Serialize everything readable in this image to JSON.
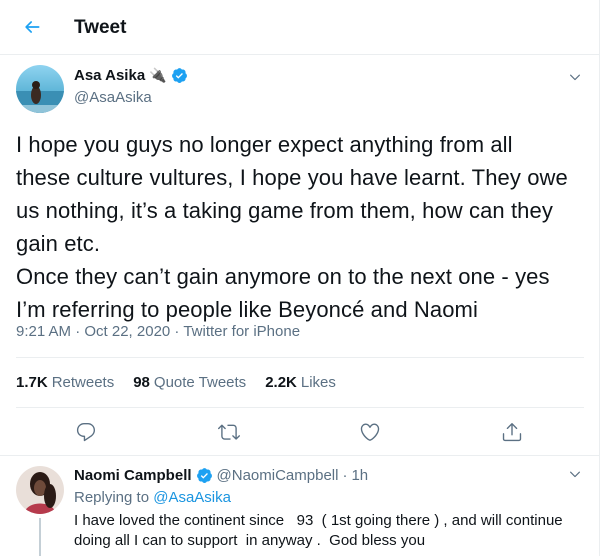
{
  "header": {
    "title": "Tweet"
  },
  "tweet": {
    "author_name": "Asa Asika",
    "author_emoji": "🔌",
    "author_handle": "@AsaAsika",
    "text_lines": [
      "I hope you guys no longer expect anything from all",
      "these culture vultures, I hope you have learnt. They owe",
      "us nothing, it’s a taking game from them, how can they",
      "gain etc.",
      "Once they can’t gain anymore on to the next one - yes",
      "I’m referring to people like Beyoncé and Naomi"
    ],
    "meta": "9:21 AM · Oct 22, 2020 · Twitter for iPhone",
    "stats": {
      "retweets_count": "1.7K",
      "retweets_label": "Retweets",
      "quotes_count": "98",
      "quotes_label": "Quote Tweets",
      "likes_count": "2.2K",
      "likes_label": "Likes"
    }
  },
  "actions": [
    "reply-icon",
    "retweet-icon",
    "like-icon",
    "share-icon"
  ],
  "reply": {
    "name": "Naomi Campbell",
    "handle": "@NaomiCampbell",
    "separator": "·",
    "time": "1h",
    "replying_prefix": "Replying to",
    "replying_mention": "@AsaAsika",
    "text_lines": [
      "I have loved the continent since   93  ( 1st going there ) , and will continue",
      "doing all I can to support  in anyway .  God bless you"
    ]
  },
  "colors": {
    "accent": "#1da1f2",
    "secondary_text": "#5b7083",
    "verified": "#1da1f2",
    "divider": "#ebeef0"
  }
}
